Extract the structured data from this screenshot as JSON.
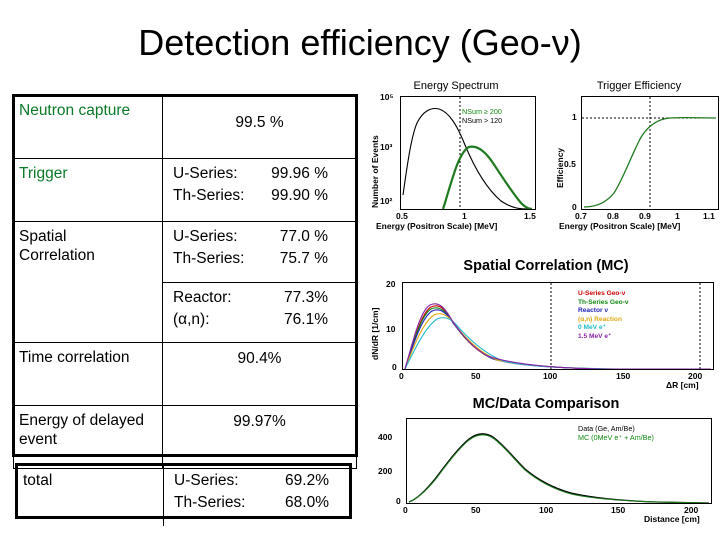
{
  "slide": {
    "title": "Detection efficiency (Geo-ν)"
  },
  "efficiency_table": {
    "rows": [
      {
        "label": "Neutron capture",
        "label_color": "#0a7a28",
        "value_style": "center",
        "values": [
          {
            "text": "99.5 %"
          }
        ]
      },
      {
        "label": "Trigger",
        "label_color": "#0a7a28",
        "value_style": "kv",
        "values": [
          {
            "key": "U-Series:",
            "val": "99.96 %"
          },
          {
            "key": "Th-Series:",
            "val": "99.90 %"
          }
        ]
      },
      {
        "label": "Spatial Correlation",
        "label_color": "#000000",
        "value_style": "kv",
        "values": [
          {
            "key": "U-Series:",
            "val": "77.0 %"
          },
          {
            "key": "Th-Series:",
            "val": "75.7 %"
          }
        ]
      },
      {
        "label": "",
        "label_color": "#000000",
        "value_style": "kv",
        "values": [
          {
            "key": "Reactor:",
            "val": "77.3%"
          },
          {
            "key": "(α,n):",
            "val": "76.1%"
          }
        ]
      },
      {
        "label": "Time correlation",
        "label_color": "#000000",
        "value_style": "center",
        "values": [
          {
            "text": "90.4%"
          }
        ]
      },
      {
        "label": "Energy of delayed event",
        "label_color": "#000000",
        "value_style": "center",
        "values": [
          {
            "text": "99.97%"
          }
        ]
      }
    ]
  },
  "total_table": {
    "label": "total",
    "values": [
      {
        "key": "U-Series:",
        "val": "69.2%"
      },
      {
        "key": "Th-Series:",
        "val": "68.0%"
      }
    ]
  },
  "charts": {
    "energy_spectrum": {
      "title": "Energy Spectrum",
      "ylabel": "Number of Events",
      "xlabel": "Energy (Positron Scale) [MeV]",
      "yticks": [
        "10⁵",
        "10³",
        "10²"
      ],
      "xticks": [
        "0.5",
        "1",
        "1.5"
      ],
      "legend": [
        {
          "text": "NSum ≥ 200",
          "color": "#118811"
        },
        {
          "text": "NSum > 120",
          "color": "#000000"
        }
      ]
    },
    "trigger_efficiency": {
      "title": "Trigger Efficiency",
      "ylabel": "Efficiency",
      "xlabel": "Energy (Positron Scale) [MeV]",
      "yticks": [
        "1",
        "0.5",
        "0"
      ],
      "xticks": [
        "0.7",
        "0.8",
        "0.9",
        "1",
        "1.1"
      ]
    },
    "spatial_correlation": {
      "title": "Spatial Correlation (MC)",
      "ylabel": "dN/dR [1/cm]",
      "xlabel": "ΔR [cm]",
      "yticks": [
        "20",
        "10",
        "0"
      ],
      "xticks": [
        "0",
        "50",
        "100",
        "150",
        "200"
      ],
      "legend": [
        {
          "text": "U-Series Geo-ν",
          "color": "#cc0000"
        },
        {
          "text": "Th-Series Geo-ν",
          "color": "#118811"
        },
        {
          "text": "Reactor ν",
          "color": "#2222bb"
        },
        {
          "text": "(α,n) Reaction",
          "color": "#ddaa11"
        },
        {
          "text": "0 MeV e⁺",
          "color": "#22bbcc"
        },
        {
          "text": "1.5 MeV e⁺",
          "color": "#8822aa"
        }
      ]
    },
    "mc_data_comparison": {
      "title": "MC/Data Comparison",
      "xlabel": "Distance [cm]",
      "yticks": [
        "400",
        "200",
        "0"
      ],
      "xticks": [
        "0",
        "50",
        "100",
        "150",
        "200"
      ],
      "legend": [
        {
          "text": "Data (Ge, Am/Be)",
          "color": "#000000"
        },
        {
          "text": "MC (0MeV e⁺ + Am/Be)",
          "color": "#118811"
        }
      ]
    }
  },
  "chart_data": [
    {
      "type": "line",
      "id": "energy_spectrum",
      "title": "Energy Spectrum",
      "xlabel": "Energy (Positron Scale) [MeV]",
      "ylabel": "Number of Events",
      "xlim": [
        0.5,
        1.5
      ],
      "ylim_log": [
        100,
        500000
      ],
      "yscale": "log",
      "grid": false,
      "legend_position": "top-right",
      "annotations": [
        "vertical dotted threshold line at ~0.92 MeV"
      ],
      "series": [
        {
          "name": "NSum > 120",
          "color": "#000000",
          "x": [
            0.5,
            0.55,
            0.6,
            0.65,
            0.7,
            0.75,
            0.8,
            0.85,
            0.9,
            0.95,
            1.0
          ],
          "y": [
            9000,
            30000,
            55000,
            62000,
            60000,
            52000,
            40000,
            27000,
            16000,
            11000,
            9000
          ]
        },
        {
          "name": "NSum ≥ 200",
          "color": "#118811",
          "x": [
            0.72,
            0.78,
            0.84,
            0.9,
            0.95,
            1.0,
            1.1,
            1.2,
            1.3,
            1.4,
            1.48
          ],
          "y": [
            110,
            700,
            3500,
            8000,
            9200,
            9000,
            7000,
            4500,
            2400,
            900,
            200
          ]
        }
      ]
    },
    {
      "type": "line",
      "id": "trigger_efficiency",
      "title": "Trigger Efficiency",
      "xlabel": "Energy (Positron Scale) [MeV]",
      "ylabel": "Efficiency",
      "xlim": [
        0.7,
        1.1
      ],
      "ylim": [
        0,
        1.15
      ],
      "grid": false,
      "annotations": [
        "horizontal dotted line at efficiency = 1",
        "vertical dotted line at 0.9 MeV"
      ],
      "series": [
        {
          "name": "Trigger efficiency",
          "color": "#118811",
          "x": [
            0.7,
            0.74,
            0.78,
            0.8,
            0.82,
            0.84,
            0.86,
            0.88,
            0.9,
            0.92,
            0.95,
            1.0,
            1.05,
            1.1
          ],
          "y": [
            0.0,
            0.01,
            0.05,
            0.12,
            0.25,
            0.42,
            0.58,
            0.7,
            0.8,
            0.88,
            0.95,
            0.99,
            1.0,
            1.0
          ]
        }
      ]
    },
    {
      "type": "line",
      "id": "spatial_correlation",
      "title": "Spatial Correlation (MC)",
      "xlabel": "ΔR [cm]",
      "ylabel": "dN/dR [1/cm]",
      "xlim": [
        0,
        210
      ],
      "ylim": [
        0,
        21
      ],
      "grid": false,
      "legend_position": "top-right",
      "annotations": [
        "vertical dotted lines at 100 cm and 200 cm"
      ],
      "series": [
        {
          "name": "U-Series Geo-ν",
          "color": "#cc0000",
          "x": [
            0,
            10,
            20,
            30,
            40,
            50,
            60,
            70,
            80,
            100,
            120,
            150,
            180,
            200
          ],
          "y": [
            0,
            9.0,
            13.6,
            13.8,
            12.0,
            9.6,
            7.2,
            5.2,
            3.8,
            2.0,
            1.0,
            0.3,
            0.1,
            0.05
          ]
        },
        {
          "name": "Th-Series Geo-ν",
          "color": "#118811",
          "x": [
            0,
            10,
            20,
            30,
            40,
            50,
            60,
            70,
            80,
            100,
            120,
            150,
            180,
            200
          ],
          "y": [
            0,
            8.6,
            13.2,
            13.6,
            12.0,
            9.8,
            7.4,
            5.4,
            4.0,
            2.1,
            1.1,
            0.35,
            0.1,
            0.05
          ]
        },
        {
          "name": "Reactor ν",
          "color": "#2222bb",
          "x": [
            0,
            10,
            20,
            30,
            40,
            50,
            60,
            70,
            80,
            100,
            120,
            150,
            180,
            200
          ],
          "y": [
            0,
            8.2,
            12.8,
            13.4,
            12.1,
            10.0,
            7.6,
            5.6,
            4.1,
            2.2,
            1.1,
            0.35,
            0.1,
            0.05
          ]
        },
        {
          "name": "(α,n) Reaction",
          "color": "#ddaa11",
          "x": [
            0,
            10,
            20,
            30,
            40,
            50,
            60,
            70,
            80,
            100,
            120,
            150,
            180,
            200
          ],
          "y": [
            0,
            7.4,
            11.8,
            12.6,
            11.8,
            10.0,
            7.8,
            5.8,
            4.3,
            2.3,
            1.2,
            0.4,
            0.12,
            0.05
          ]
        },
        {
          "name": "0 MeV e⁺",
          "color": "#22bbcc",
          "x": [
            0,
            10,
            20,
            30,
            40,
            50,
            60,
            70,
            80,
            100,
            120,
            150,
            180,
            200
          ],
          "y": [
            0,
            6.4,
            10.6,
            11.8,
            11.6,
            10.2,
            8.2,
            6.3,
            4.8,
            2.7,
            1.5,
            0.55,
            0.2,
            0.08
          ]
        },
        {
          "name": "1.5 MeV e⁺",
          "color": "#8822aa",
          "x": [
            0,
            10,
            20,
            30,
            40,
            50,
            60,
            70,
            80,
            100,
            120,
            150,
            180,
            200
          ],
          "y": [
            0,
            9.4,
            14.0,
            14.0,
            12.0,
            9.4,
            7.0,
            5.0,
            3.6,
            1.9,
            0.9,
            0.28,
            0.08,
            0.04
          ]
        }
      ]
    },
    {
      "type": "line",
      "id": "mc_data_comparison",
      "title": "MC/Data Comparison",
      "xlabel": "Distance [cm]",
      "ylabel": "",
      "xlim": [
        0,
        200
      ],
      "ylim": [
        0,
        520
      ],
      "grid": false,
      "legend_position": "top-right",
      "series": [
        {
          "name": "Data (Ge, Am/Be)",
          "color": "#000000",
          "x": [
            0,
            10,
            20,
            30,
            40,
            50,
            55,
            60,
            70,
            80,
            90,
            100,
            110,
            120,
            140,
            160,
            180,
            200
          ],
          "y": [
            0,
            40,
            140,
            290,
            420,
            465,
            460,
            465,
            400,
            330,
            250,
            180,
            130,
            100,
            50,
            25,
            10,
            3
          ]
        },
        {
          "name": "MC (0MeV e⁺ + Am/Be)",
          "color": "#118811",
          "x": [
            0,
            10,
            20,
            30,
            40,
            50,
            55,
            60,
            70,
            80,
            90,
            100,
            110,
            120,
            140,
            160,
            180,
            200
          ],
          "y": [
            0,
            42,
            145,
            285,
            425,
            470,
            465,
            458,
            395,
            325,
            245,
            175,
            128,
            98,
            48,
            24,
            9,
            3
          ]
        }
      ]
    }
  ]
}
